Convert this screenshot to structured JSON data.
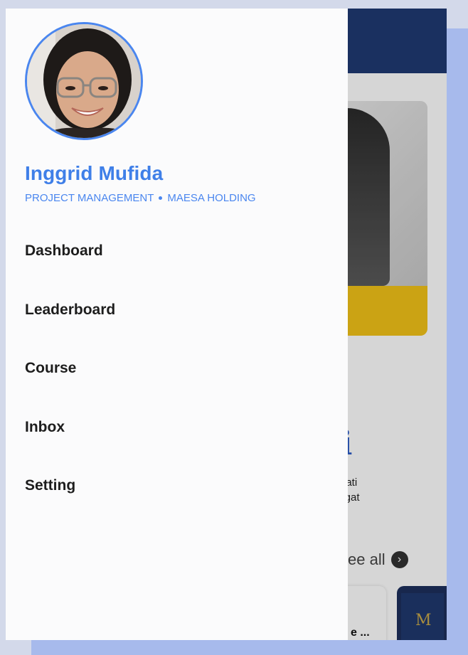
{
  "profile": {
    "name": "Inggrid Mufida",
    "department": "PROJECT MANAGEMENT",
    "company": "MAESA HOLDING"
  },
  "menu": {
    "items": [
      {
        "label": "Dashboard"
      },
      {
        "label": "Leaderboard"
      },
      {
        "label": "Course"
      },
      {
        "label": "Inbox"
      },
      {
        "label": "Setting"
      }
    ]
  },
  "background_app": {
    "brand_letter": "i",
    "motto_line1": "i Hati",
    "motto_line2": "angat",
    "see_all_label": "see all",
    "course_card_title": "e ...",
    "book_card_letter": "M"
  },
  "colors": {
    "accent": "#3f7fe8",
    "header": "#1f3a73",
    "banner_strip": "#f2c318",
    "drawer_bg": "#fbfbfc",
    "backdrop": "#a7baec"
  },
  "icons": {
    "see_all": "chevron-right-circle-icon"
  }
}
